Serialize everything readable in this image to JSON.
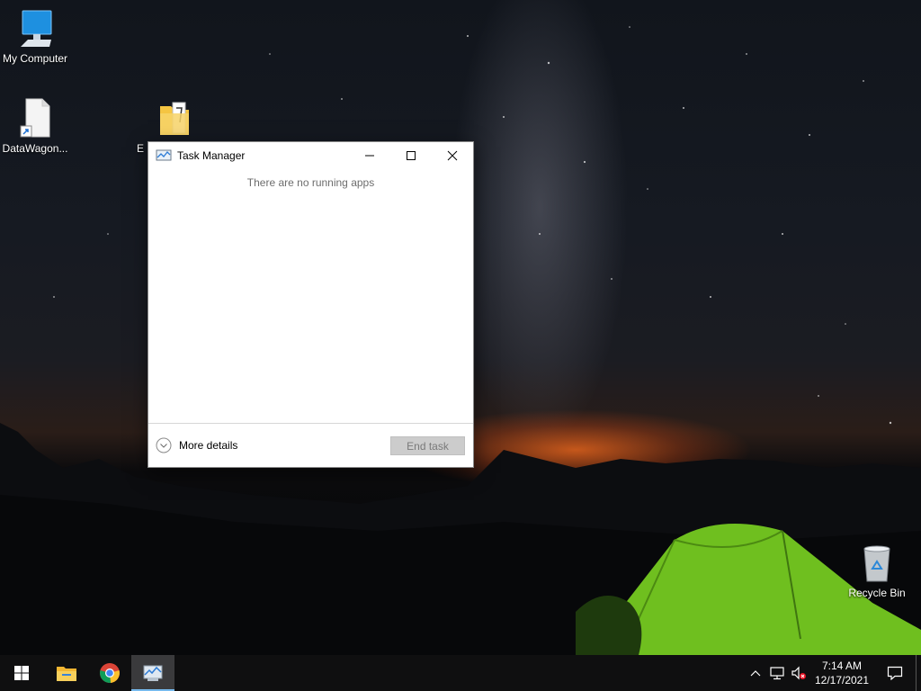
{
  "desktop": {
    "icons": [
      {
        "label": "My Computer",
        "icon": "computer-icon"
      },
      {
        "label": "DataWagon...",
        "icon": "file-shortcut-icon"
      },
      {
        "label": "E",
        "icon": "folder-icon"
      },
      {
        "label": "Recycle Bin",
        "icon": "recycle-bin-icon"
      }
    ]
  },
  "task_manager": {
    "title": "Task Manager",
    "empty_message": "There are no running apps",
    "more_details_label": "More details",
    "end_task_label": "End task",
    "end_task_enabled": false
  },
  "taskbar": {
    "pinned": [
      {
        "name": "start-button",
        "icon": "windows-logo-icon"
      },
      {
        "name": "file-explorer",
        "icon": "folder-icon"
      },
      {
        "name": "chrome",
        "icon": "chrome-icon"
      },
      {
        "name": "task-manager",
        "icon": "task-manager-icon",
        "active": true
      }
    ],
    "tray": {
      "time": "7:14 AM",
      "date": "12/17/2021",
      "icons": [
        "chevron-up-icon",
        "network-icon",
        "volume-muted-icon",
        "notification-icon"
      ]
    }
  },
  "colors": {
    "accent": "#76b9ed",
    "taskbar": "#0f0f10",
    "end_task_disabled_bg": "#cccccc",
    "tent_green": "#7ed321"
  }
}
